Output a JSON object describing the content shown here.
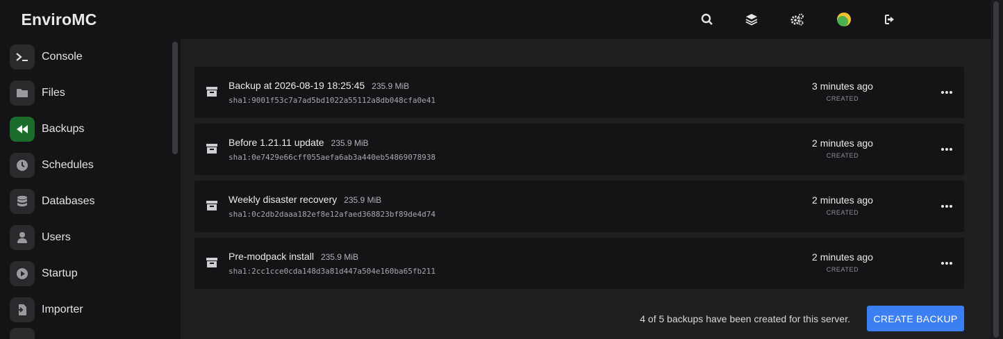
{
  "app": {
    "title": "EnviroMC"
  },
  "topbar": {
    "icons": [
      "search-icon",
      "layers-icon",
      "gears-icon",
      "avatar",
      "logout-icon"
    ]
  },
  "sidebar": {
    "items": [
      {
        "label": "Console",
        "icon": "terminal-icon",
        "active": false
      },
      {
        "label": "Files",
        "icon": "folder-icon",
        "active": false
      },
      {
        "label": "Backups",
        "icon": "rewind-icon",
        "active": true
      },
      {
        "label": "Schedules",
        "icon": "clock-icon",
        "active": false
      },
      {
        "label": "Databases",
        "icon": "database-icon",
        "active": false
      },
      {
        "label": "Users",
        "icon": "user-icon",
        "active": false
      },
      {
        "label": "Startup",
        "icon": "play-icon",
        "active": false
      },
      {
        "label": "Importer",
        "icon": "import-icon",
        "active": false
      }
    ]
  },
  "backups": [
    {
      "name": "Backup at 2026-08-19 18:25:45",
      "size": "235.9 MiB",
      "hash": "sha1:9001f53c7a7ad5bd1022a55112a8db048cfa0e41",
      "time": "3 minutes ago",
      "status": "CREATED"
    },
    {
      "name": "Before 1.21.11 update",
      "size": "235.9 MiB",
      "hash": "sha1:0e7429e66cff055aefa6ab3a440eb54869078938",
      "time": "2 minutes ago",
      "status": "CREATED"
    },
    {
      "name": "Weekly disaster recovery",
      "size": "235.9 MiB",
      "hash": "sha1:0c2db2daaa182ef8e12afaed368823bf89de4d74",
      "time": "2 minutes ago",
      "status": "CREATED"
    },
    {
      "name": "Pre-modpack install",
      "size": "235.9 MiB",
      "hash": "sha1:2cc1cce0cda148d3a81d447a504e160ba65fb211",
      "time": "2 minutes ago",
      "status": "CREATED"
    }
  ],
  "footer": {
    "count_text": "4 of 5 backups have been created for this server.",
    "create_label": "CREATE BACKUP"
  },
  "colors": {
    "accent": "#3b7ff2",
    "active_nav": "#1b6b2a"
  }
}
